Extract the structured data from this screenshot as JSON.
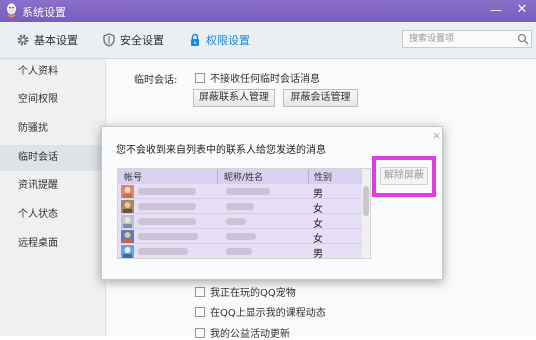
{
  "window": {
    "title": "系统设置",
    "min_glyph": "—",
    "close_glyph": "✕"
  },
  "tabs": [
    {
      "label": "基本设置",
      "icon": "gear-icon"
    },
    {
      "label": "安全设置",
      "icon": "shield-icon"
    },
    {
      "label": "权限设置",
      "icon": "lock-icon",
      "active": true
    }
  ],
  "search": {
    "placeholder": "搜索设置项"
  },
  "sidebar": {
    "items": [
      {
        "label": "个人资料"
      },
      {
        "label": "空间权限"
      },
      {
        "label": "防骚扰"
      },
      {
        "label": "临时会话",
        "active": true
      },
      {
        "label": "资讯提醒"
      },
      {
        "label": "个人状态"
      },
      {
        "label": "远程桌面"
      }
    ]
  },
  "temp_session": {
    "label": "临时会话:",
    "checkbox_label": "不接收任何临时会话消息",
    "btn_blocked_contacts": "屏蔽联系人管理",
    "btn_blocked_sessions": "屏蔽会话管理"
  },
  "status_options": [
    {
      "label": "我正在玩的QQ宠物"
    },
    {
      "label": "在QQ上显示我的课程动态"
    },
    {
      "label": "我的公益活动更新"
    }
  ],
  "dialog": {
    "close_glyph": "×",
    "title": "您不会收到来自列表中的联系人给您发送的消息",
    "columns": [
      "帐号",
      "昵称/姓名",
      "性别"
    ],
    "rows": [
      {
        "gender": "男"
      },
      {
        "gender": "女"
      },
      {
        "gender": "女"
      },
      {
        "gender": "女"
      },
      {
        "gender": "男"
      }
    ],
    "unblock_button": "解除屏蔽"
  },
  "colors": {
    "titlebar": "#7c5fc0",
    "highlight": "#e13ce3",
    "table_header": "#dad0f0",
    "table_row": "#e7dff5",
    "active_tab": "#1b8be0"
  }
}
